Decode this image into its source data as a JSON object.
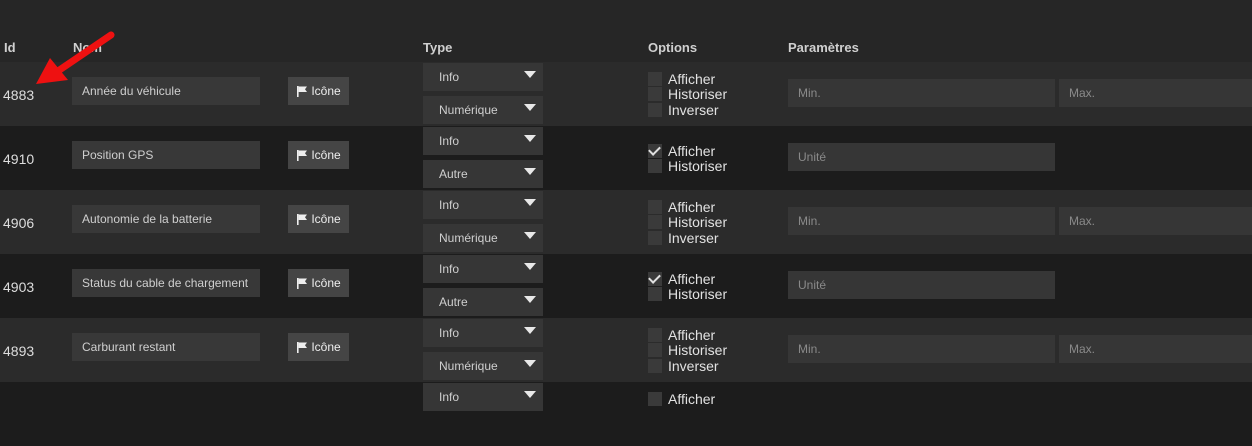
{
  "headers": {
    "id": "Id",
    "name": "Nom",
    "type": "Type",
    "options": "Options",
    "params": "Paramètres"
  },
  "rows": [
    {
      "id": "4883",
      "name": "Année du véhicule",
      "icon_label": "Icône",
      "type": "Info",
      "subtype": "Numérique",
      "options": [
        {
          "label": "Afficher",
          "checked": false
        },
        {
          "label": "Historiser",
          "checked": false
        },
        {
          "label": "Inverser",
          "checked": false
        }
      ],
      "params": [
        "Min.",
        "Max."
      ]
    },
    {
      "id": "4910",
      "name": "Position GPS",
      "icon_label": "Icône",
      "type": "Info",
      "subtype": "Autre",
      "options": [
        {
          "label": "Afficher",
          "checked": true
        },
        {
          "label": "Historiser",
          "checked": false
        }
      ],
      "params": [
        "Unité"
      ]
    },
    {
      "id": "4906",
      "name": "Autonomie de la batterie",
      "icon_label": "Icône",
      "type": "Info",
      "subtype": "Numérique",
      "options": [
        {
          "label": "Afficher",
          "checked": false
        },
        {
          "label": "Historiser",
          "checked": false
        },
        {
          "label": "Inverser",
          "checked": false
        }
      ],
      "params": [
        "Min.",
        "Max."
      ]
    },
    {
      "id": "4903",
      "name": "Status du cable de chargement",
      "icon_label": "Icône",
      "type": "Info",
      "subtype": "Autre",
      "options": [
        {
          "label": "Afficher",
          "checked": true
        },
        {
          "label": "Historiser",
          "checked": false
        }
      ],
      "params": [
        "Unité"
      ]
    },
    {
      "id": "4893",
      "name": "Carburant restant",
      "icon_label": "Icône",
      "type": "Info",
      "subtype": "Numérique",
      "options": [
        {
          "label": "Afficher",
          "checked": false
        },
        {
          "label": "Historiser",
          "checked": false
        },
        {
          "label": "Inverser",
          "checked": false
        }
      ],
      "params": [
        "Min.",
        "Max."
      ]
    },
    {
      "id": "",
      "name": "",
      "icon_label": "",
      "type": "Info",
      "subtype": "",
      "options": [
        {
          "label": "Afficher",
          "checked": false
        }
      ],
      "params": []
    }
  ],
  "colors": {
    "annotation_arrow": "#ee1111"
  }
}
